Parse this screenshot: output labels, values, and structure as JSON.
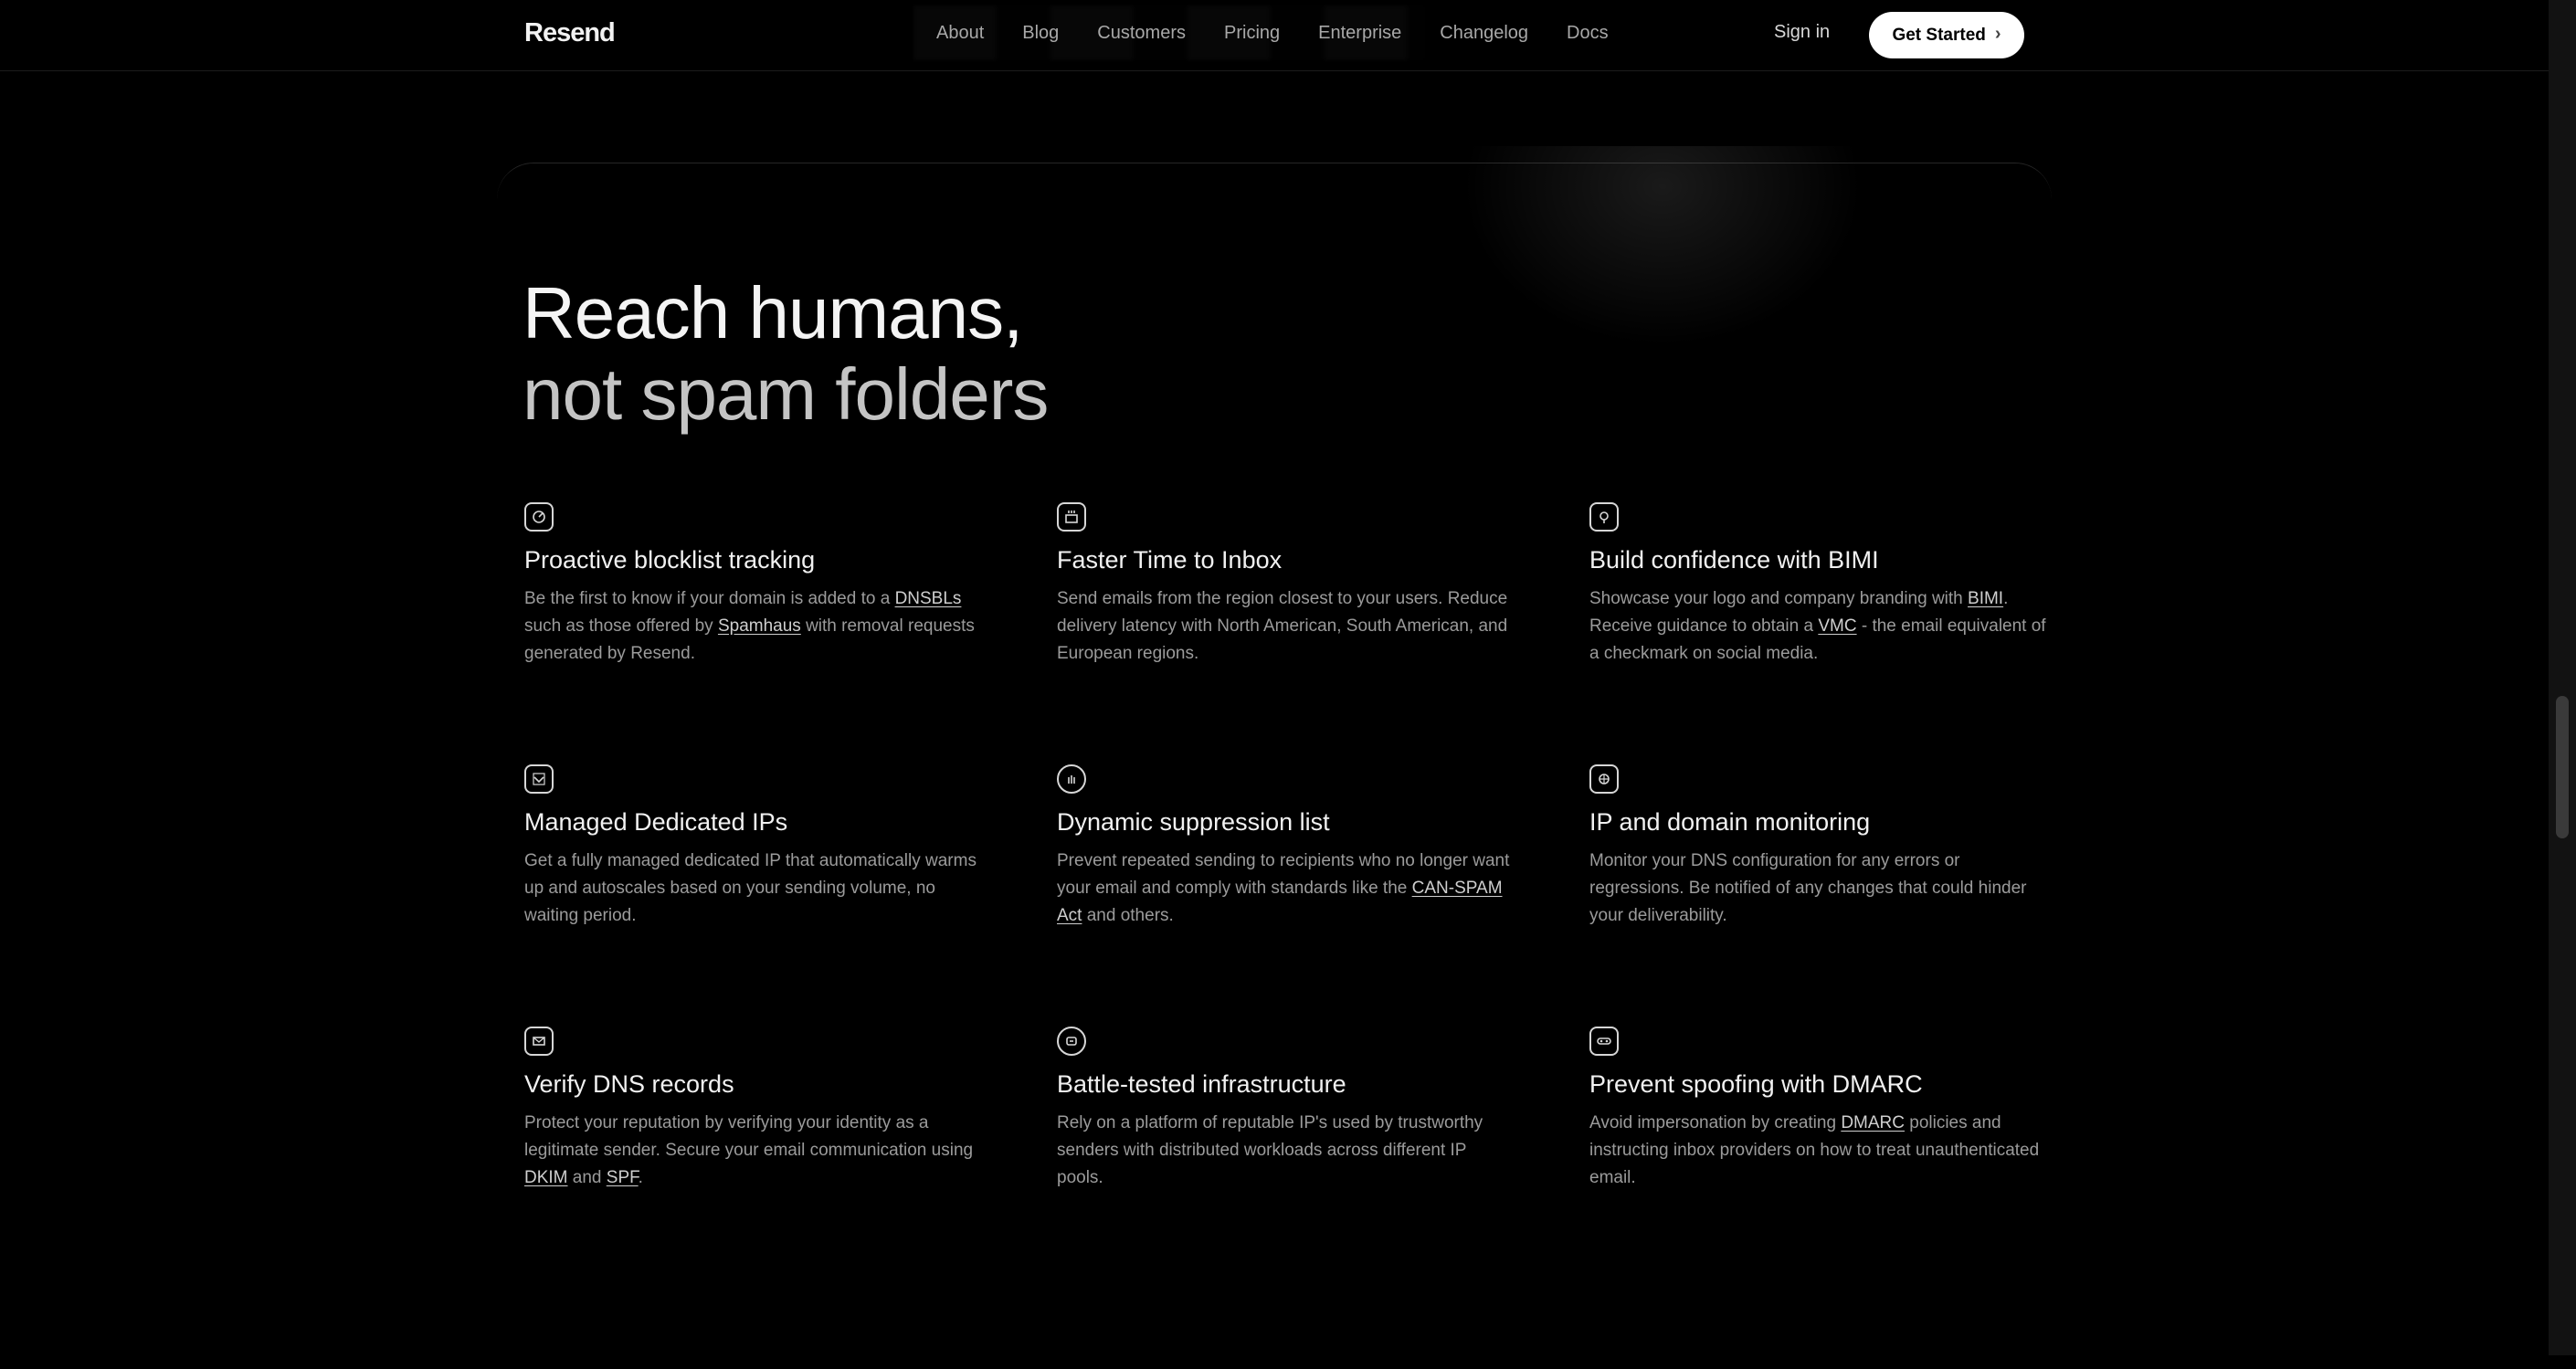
{
  "nav": {
    "logo": "Resend",
    "links": [
      "About",
      "Blog",
      "Customers",
      "Pricing",
      "Enterprise",
      "Changelog",
      "Docs"
    ],
    "signin": "Sign in",
    "cta": "Get Started"
  },
  "heading": {
    "line1": "Reach humans,",
    "line2": "not spam folders"
  },
  "features": [
    {
      "icon": "blocklist-radar-icon",
      "title": "Proactive blocklist tracking",
      "desc": [
        "Be the first to know if your domain is added to a ",
        {
          "link": "DNSBLs"
        },
        " such as those offered by ",
        {
          "link": "Spamhaus"
        },
        " with removal requests generated by Resend."
      ]
    },
    {
      "icon": "inbox-speed-icon",
      "title": "Faster Time to Inbox",
      "desc": [
        "Send emails from the region closest to your users. Reduce delivery latency with North American, South American, and European regions."
      ]
    },
    {
      "icon": "bimi-badge-icon",
      "title": "Build confidence with BIMI",
      "desc": [
        "Showcase your logo and company branding with ",
        {
          "link": "BIMI"
        },
        ". Receive guidance to obtain a ",
        {
          "link": "VMC"
        },
        " - the email equivalent of a checkmark on social media."
      ]
    },
    {
      "icon": "dedicated-ip-icon",
      "title": "Managed Dedicated IPs",
      "desc": [
        "Get a fully managed dedicated IP that automatically warms up and autoscales based on your sending volume, no waiting period."
      ]
    },
    {
      "icon": "suppression-hand-icon",
      "title": "Dynamic suppression list",
      "desc": [
        "Prevent repeated sending to recipients who no longer want your email and comply with standards like the ",
        {
          "link": "CAN-SPAM Act"
        },
        " and others."
      ]
    },
    {
      "icon": "globe-monitor-icon",
      "title": "IP and domain monitoring",
      "desc": [
        "Monitor your DNS configuration for any errors or regressions. Be notified of any changes that could hinder your deliverability."
      ]
    },
    {
      "icon": "dns-envelope-icon",
      "title": "Verify DNS records",
      "desc": [
        "Protect your reputation by verifying your identity as a legitimate sender. Secure your email communication using ",
        {
          "link": "DKIM"
        },
        " and ",
        {
          "link": "SPF"
        },
        "."
      ]
    },
    {
      "icon": "infrastructure-shield-icon",
      "title": "Battle-tested infrastructure",
      "desc": [
        "Rely on a platform of reputable IP's used by trustworthy senders with distributed workloads across different IP pools."
      ]
    },
    {
      "icon": "spoofing-mask-icon",
      "title": "Prevent spoofing with DMARC",
      "desc": [
        "Avoid impersonation by creating ",
        {
          "link": "DMARC"
        },
        " policies and instructing inbox providers on how to treat unauthenticated email."
      ]
    }
  ]
}
